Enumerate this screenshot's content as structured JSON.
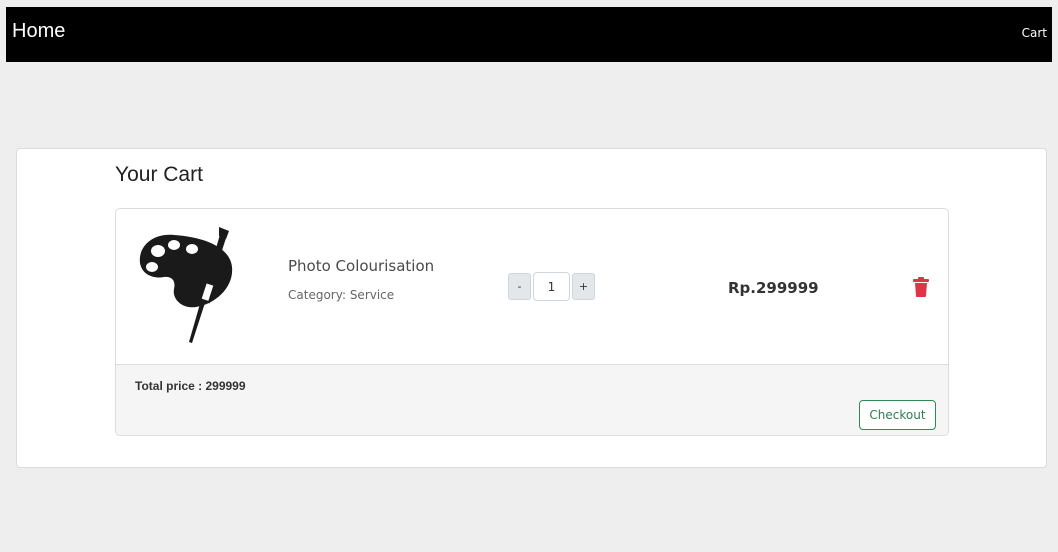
{
  "nav": {
    "brand": "Home",
    "cart_link": "Cart"
  },
  "cart": {
    "title": "Your Cart",
    "items": [
      {
        "name": "Photo Colourisation",
        "category_label": "Category:",
        "category": "Service",
        "quantity": "1",
        "decrement_label": "-",
        "increment_label": "+",
        "price": "Rp.299999",
        "image_icon": "paint-palette-icon",
        "delete_icon": "trash-icon"
      }
    ],
    "total_label": "Total price :",
    "total_value": "299999",
    "checkout_label": "Checkout"
  },
  "colors": {
    "navbar_bg": "#000000",
    "page_bg": "#eeeeee",
    "delete_red": "#dc3545",
    "checkout_green": "#2e8b57"
  }
}
